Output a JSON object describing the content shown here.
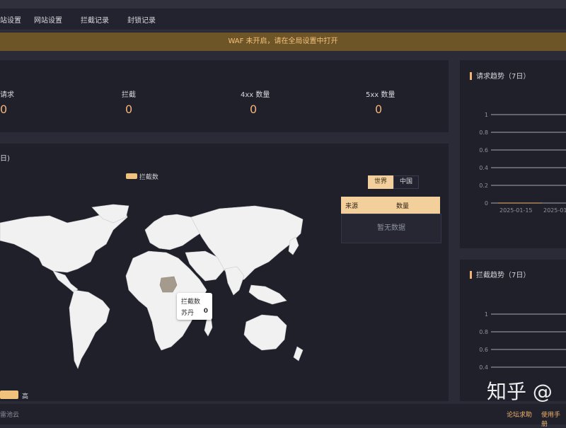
{
  "nav": {
    "items": [
      "站设置",
      "网站设置",
      "拦截记录",
      "封锁记录"
    ]
  },
  "warning": {
    "text": "WAF 未开启，请在全局设置中打开"
  },
  "stats": [
    {
      "label": "请求",
      "value": "0"
    },
    {
      "label": "拦截",
      "value": "0"
    },
    {
      "label": "4xx 数量",
      "value": "0"
    },
    {
      "label": "5xx 数量",
      "value": "0"
    }
  ],
  "map_panel": {
    "title_fragment": "日)",
    "legend_label": "拦截数",
    "visual_map_high": "高",
    "tabs": [
      "世界",
      "中国"
    ],
    "active_tab": "世界",
    "table_headers": [
      "来源",
      "数量"
    ],
    "empty_text": "暂无数据",
    "tooltip": {
      "title": "拦截数",
      "region": "苏丹",
      "value": "0"
    }
  },
  "request_chart": {
    "title": "请求趋势（7日）",
    "y_ticks": [
      "1",
      "0.8",
      "0.6",
      "0.4",
      "0.2",
      "0"
    ],
    "x_ticks": [
      "2025-01-15",
      "2025-01"
    ]
  },
  "block_chart": {
    "title": "拦截趋势（7日）",
    "y_ticks": [
      "1",
      "0.8",
      "0.6",
      "0.4"
    ]
  },
  "chart_data": [
    {
      "type": "line",
      "title": "请求趋势（7日）",
      "x": [
        "2025-01-15",
        "2025-01"
      ],
      "series": [
        {
          "values": [
            0,
            0
          ]
        }
      ],
      "ylim": [
        0,
        1
      ],
      "grid": true
    },
    {
      "type": "line",
      "title": "拦截趋势（7日）",
      "series": [],
      "ylim": [
        0.4,
        1
      ],
      "grid": true
    }
  ],
  "footer": {
    "left_fragment": "雷池云",
    "links": [
      "论坛求助",
      "使用手册"
    ]
  },
  "watermark": "知乎 @",
  "colors": {
    "accent": "#f2b46e",
    "warning_bg": "#6e5528",
    "panel_bg": "#1f2029",
    "page_bg": "#2a2b37"
  }
}
